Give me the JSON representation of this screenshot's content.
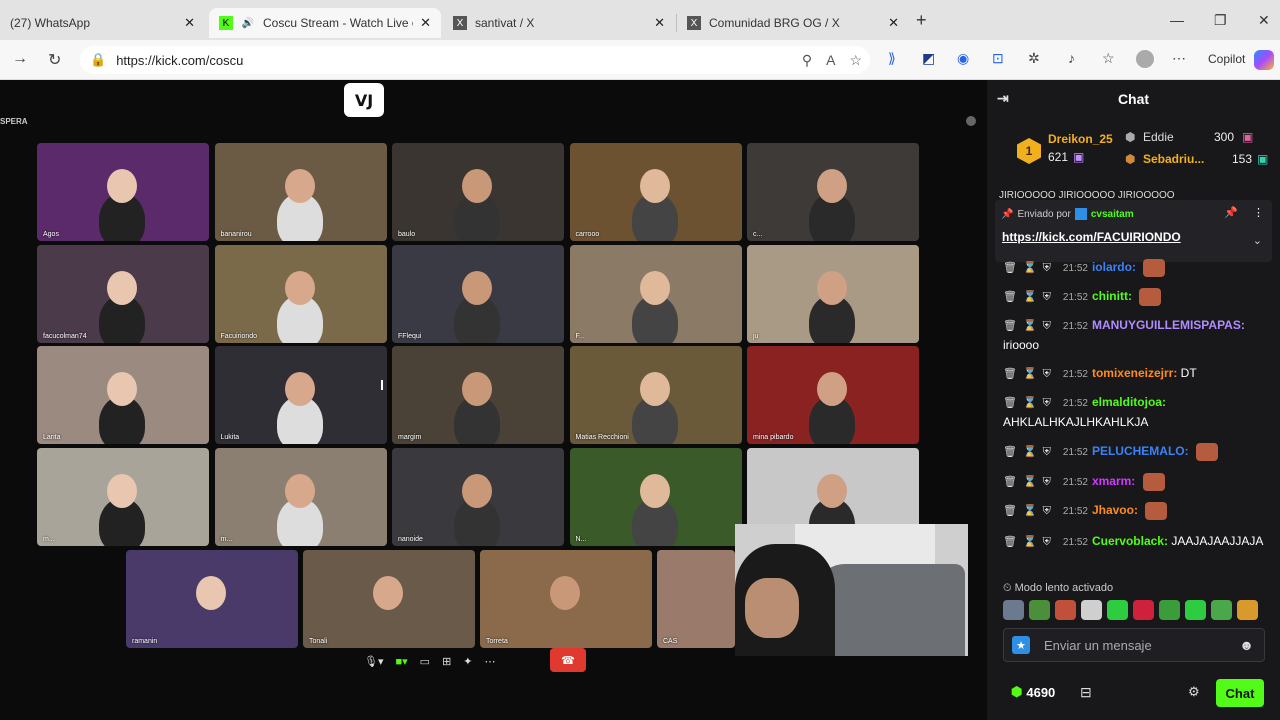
{
  "browser": {
    "tabs": [
      {
        "title": "(27) WhatsApp",
        "active": false
      },
      {
        "title": "Coscu Stream - Watch Live o",
        "active": true
      },
      {
        "title": "santivat / X",
        "active": false
      },
      {
        "title": "Comunidad BRG OG / X",
        "active": false
      }
    ],
    "url": "https://kick.com/coscu",
    "copilot_label": "Copilot"
  },
  "video": {
    "logo_text": "VJ",
    "corner_text": "SPERA",
    "participants": [
      "Agos",
      "bananirou",
      "baulo",
      "carrooo",
      "c...",
      "facucolman74",
      "Facuiriondo",
      "FFlequi",
      "F...",
      "ju",
      "Larita",
      "Lukita",
      "margim",
      "Matias Recchioni",
      "mina pibardo",
      "m...",
      "m...",
      "nanoide",
      "N...",
      "",
      "ramanin",
      "Tonali",
      "Torreta",
      "CAS"
    ]
  },
  "chat": {
    "title": "Chat",
    "leaderboard": [
      {
        "rank": "1",
        "name": "Dreikon_25",
        "value": "621",
        "color": "#f2b01e"
      },
      {
        "name": "Eddie",
        "value": "300",
        "color": "#dddddd"
      },
      {
        "name": "Sebadriu...",
        "value": "153",
        "color": "#f2b01e"
      }
    ],
    "cut_text": "JIRIOOOOO JIRIOOOOO JIRIOOOOO",
    "pinned": {
      "sent_by_label": "Enviado por",
      "user": "cvsaitam",
      "link": "https://kick.com/FACUIRIONDO"
    },
    "messages": [
      {
        "time": "21:52",
        "user": "iolardo:",
        "text": "",
        "color": "#3b82f6",
        "emote": true
      },
      {
        "time": "21:52",
        "user": "chinitt:",
        "text": "",
        "color": "#53fc18",
        "emote": true
      },
      {
        "time": "21:52",
        "user": "MANUYGUILLEMISPAPAS:",
        "text": "irioooo",
        "color": "#b08cff",
        "emote": false
      },
      {
        "time": "21:52",
        "user": "tomixeneizejrr:",
        "text": "DT",
        "color": "#ff8c1a",
        "emote": false
      },
      {
        "time": "21:52",
        "user": "elmalditojoa:",
        "text": "AHKLALHKAJLHKAHLKJA",
        "color": "#53fc18",
        "emote": false
      },
      {
        "time": "21:52",
        "user": "PELUCHEMALO:",
        "text": "",
        "color": "#3b82f6",
        "emote": true
      },
      {
        "time": "21:52",
        "user": "xmarm:",
        "text": "",
        "color": "#d03bff",
        "emote": true
      },
      {
        "time": "21:52",
        "user": "Jhavoo:",
        "text": "",
        "color": "#ff8c1a",
        "emote": true
      },
      {
        "time": "21:52",
        "user": "Cuervoblack:",
        "text": "JAAJAJAAJJAJA",
        "color": "#53fc18",
        "emote": false
      }
    ],
    "slow_mode": "Modo lento activado",
    "input_placeholder": "Enviar un mensaje",
    "points": "4690",
    "chat_button": "Chat"
  }
}
